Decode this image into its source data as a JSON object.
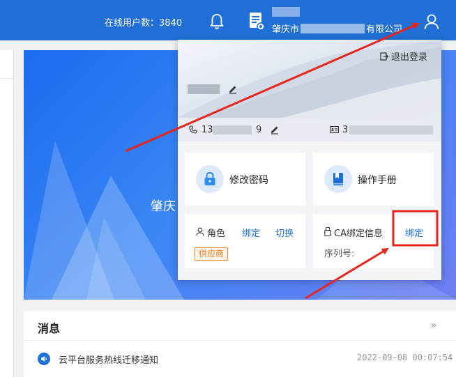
{
  "topbar": {
    "online_label": "在线用户数：3840",
    "company_prefix": "肇庆市",
    "company_suffix": "有限公司",
    "bg_color": "#1f6fd6"
  },
  "banner": {
    "text": "肇庆"
  },
  "dropdown": {
    "logout_label": "退出登录",
    "phone_prefix": "13",
    "phone_suffix": "9",
    "id_prefix": "3",
    "tiles": {
      "change_password": "修改密码",
      "manual": "操作手册"
    },
    "role": {
      "label": "角色",
      "bind": "绑定",
      "switch": "切换",
      "badge": "供应商"
    },
    "ca": {
      "label": "CA绑定信息",
      "bind": "绑定",
      "serial_label": "序列号:"
    }
  },
  "messages": {
    "title": "消息",
    "more": "»",
    "items": [
      {
        "text": "云平台服务热线迁移通知",
        "date": "2022-09-08 00:07:54"
      }
    ]
  },
  "icons": [
    "bell-icon",
    "document-icon",
    "user-icon",
    "logout-icon",
    "edit-icon",
    "phone-icon",
    "id-card-icon",
    "lock-icon",
    "book-icon",
    "person-icon",
    "usb-key-icon",
    "speaker-icon"
  ],
  "colors": {
    "accent": "#1f6fd6",
    "badge": "#e8781d",
    "annotation": "#e8241b"
  }
}
